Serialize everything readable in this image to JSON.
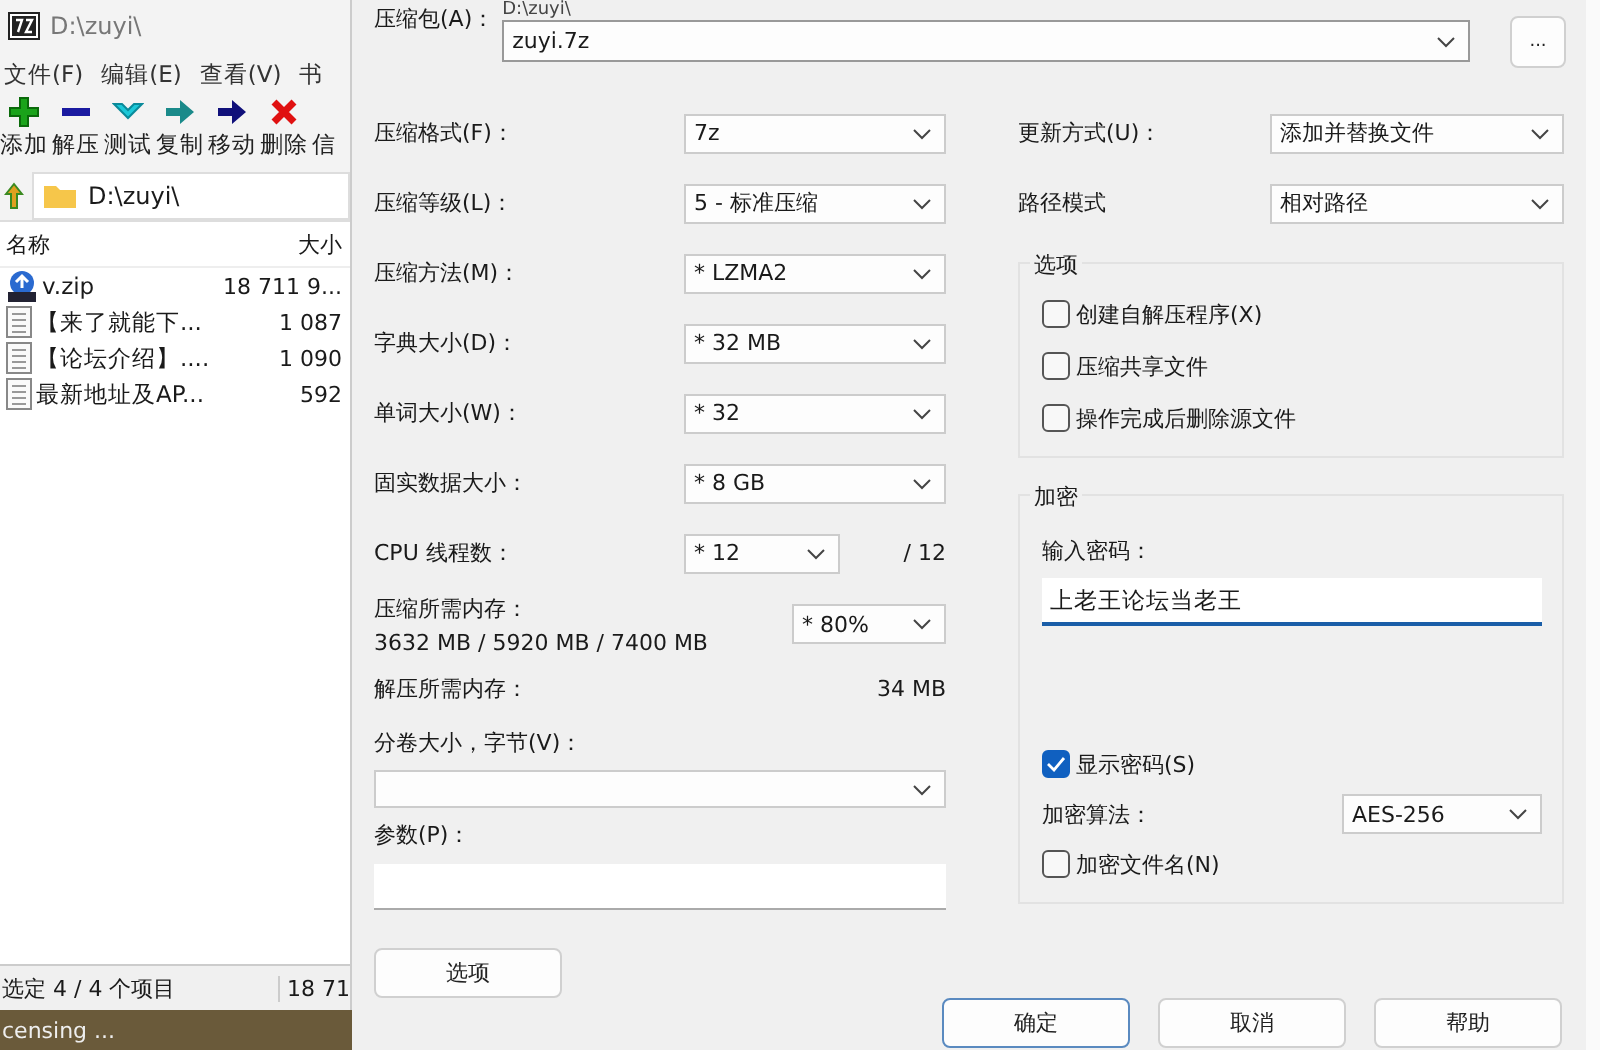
{
  "file_manager": {
    "title": "D:\\zuyi\\",
    "menu": [
      "文件(F)",
      "编辑(E)",
      "查看(V)",
      "书"
    ],
    "toolbar": [
      {
        "label": "添加",
        "kind": "add"
      },
      {
        "label": "解压",
        "kind": "extract"
      },
      {
        "label": "测试",
        "kind": "test"
      },
      {
        "label": "复制",
        "kind": "copy"
      },
      {
        "label": "移动",
        "kind": "move"
      },
      {
        "label": "删除",
        "kind": "delete"
      },
      {
        "label": "信",
        "kind": "info"
      }
    ],
    "address": "D:\\zuyi\\",
    "columns": [
      "名称",
      "大小"
    ],
    "files": [
      {
        "name": "v.zip",
        "size": "18 711 9...",
        "kind": "archive"
      },
      {
        "name": "【来了就能下...",
        "size": "1 087",
        "kind": "document"
      },
      {
        "name": "【论坛介绍】....",
        "size": "1 090",
        "kind": "document"
      },
      {
        "name": "最新地址及AP...",
        "size": "592",
        "kind": "document"
      }
    ],
    "status": "选定 4 / 4 个项目",
    "status_size": "18 71"
  },
  "desktop_caption": "censing ...",
  "dialog": {
    "archive": {
      "label": "压缩包(A)：",
      "path": "D:\\zuyi\\",
      "value": "zuyi.7z",
      "browse": "..."
    },
    "left_fields": [
      {
        "kind": "select",
        "label": "压缩格式(F)：",
        "value": "7z"
      },
      {
        "kind": "select",
        "label": "压缩等级(L)：",
        "value": "5 - 标准压缩"
      },
      {
        "kind": "select",
        "label": "压缩方法(M)：",
        "value": "*  LZMA2"
      },
      {
        "kind": "select",
        "label": "字典大小(D)：",
        "value": "*  32 MB"
      },
      {
        "kind": "select",
        "label": "单词大小(W)：",
        "value": "*  32"
      },
      {
        "kind": "select",
        "label": "固实数据大小：",
        "value": "*  8 GB"
      },
      {
        "kind": "narrow",
        "label": "CPU 线程数：",
        "value": "*  12",
        "suffix": "/ 12"
      },
      {
        "kind": "memory",
        "label": "压缩所需内存：",
        "detail": "3632 MB / 5920 MB / 7400 MB",
        "value": "*  80%"
      },
      {
        "kind": "readout",
        "label": "解压所需内存：",
        "value": "34 MB"
      }
    ],
    "volume_label": "分卷大小，字节(V)：",
    "params_label": "参数(P)：",
    "options_button": "选项",
    "right_fields": [
      {
        "label": "更新方式(U)：",
        "value": "添加并替换文件"
      },
      {
        "label": "路径模式",
        "value": "相对路径"
      }
    ],
    "options_group": {
      "title": "选项",
      "items": [
        {
          "label": "创建自解压程序(X)",
          "checked": false
        },
        {
          "label": "压缩共享文件",
          "checked": false
        },
        {
          "label": "操作完成后删除源文件",
          "checked": false
        }
      ]
    },
    "encryption": {
      "title": "加密",
      "password_label": "输入密码：",
      "password": "上老王论坛当老王",
      "show_password": {
        "label": "显示密码(S)",
        "checked": true
      },
      "method_label": "加密算法：",
      "method": "AES-256",
      "encrypt_names": {
        "label": "加密文件名(N)",
        "checked": false
      }
    },
    "buttons": [
      {
        "label": "确定",
        "default": true
      },
      {
        "label": "取消",
        "default": false
      },
      {
        "label": "帮助",
        "default": false
      }
    ]
  }
}
